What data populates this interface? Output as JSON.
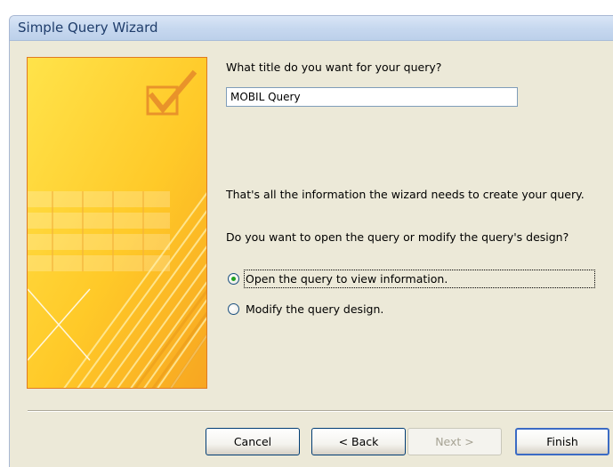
{
  "window": {
    "title": "Simple Query Wizard"
  },
  "wizard": {
    "question_title": "What title do you want for your query?",
    "title_value": "MOBIL Query",
    "info_text": "That's all the information the wizard needs to create your query.",
    "question_action": "Do you want to open the query or modify the query's design?",
    "options": [
      {
        "label": "Open the query to view information.",
        "checked": true
      },
      {
        "label": "Modify the query design.",
        "checked": false
      }
    ]
  },
  "buttons": {
    "cancel": "Cancel",
    "back": "< Back",
    "next": "Next >",
    "finish": "Finish"
  },
  "icons": {
    "checkbox": "checked-box-icon"
  },
  "colors": {
    "graphic_orange": "#f7a521",
    "graphic_yellow": "#ffd633",
    "radio_checked": "#21a121",
    "finish_border": "#3b6bc4"
  }
}
